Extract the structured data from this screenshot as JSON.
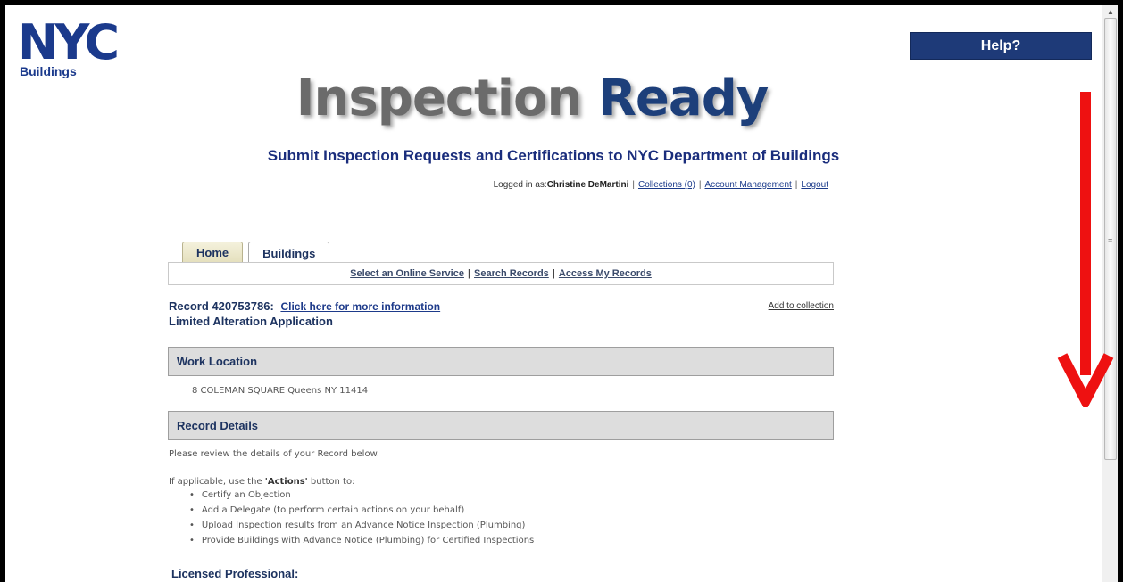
{
  "logo": {
    "text": "NYC",
    "sub": "Buildings"
  },
  "help": {
    "label": "Help?"
  },
  "title": {
    "word1": "Inspection",
    "word2": "Ready"
  },
  "subtitle": "Submit Inspection Requests and Certifications to NYC Department of Buildings",
  "login": {
    "prefix": "Logged in as:",
    "user": "Christine DeMartini",
    "collections": "Collections (0)",
    "account": "Account Management",
    "logout": "Logout"
  },
  "tabs": [
    {
      "label": "Home"
    },
    {
      "label": "Buildings"
    }
  ],
  "subnav": {
    "select_service": "Select an Online Service",
    "search_records": "Search Records",
    "access_records": "Access My Records"
  },
  "record": {
    "label": "Record 420753786:",
    "more_info": "Click here for more information",
    "type": "Limited Alteration Application",
    "add_collection": "Add to collection"
  },
  "work_location": {
    "heading": "Work Location",
    "address": "8 COLEMAN SQUARE Queens NY 11414"
  },
  "record_details": {
    "heading": "Record Details",
    "intro": "Please review the details of your Record below.",
    "actions_prefix": "If applicable, use the ",
    "actions_word": "'Actions'",
    "actions_suffix": " button to:",
    "items": [
      "Certify an Objection",
      "Add a Delegate (to perform certain actions on your behalf)",
      "Upload Inspection results from an Advance Notice Inspection (Plumbing)",
      "Provide Buildings with Advance Notice (Plumbing) for Certified Inspections"
    ]
  },
  "licensed_professional": {
    "heading": "Licensed Professional:"
  },
  "colors": {
    "brand_blue": "#1d3f7a",
    "help_bg": "#1e3a78",
    "annotation_red": "#ee1111"
  }
}
